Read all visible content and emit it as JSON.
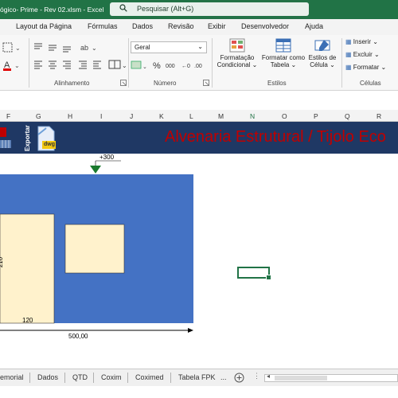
{
  "titlebar": {
    "file_title": "ógico- Prime - Rev 02.xlsm  -  Excel",
    "search_placeholder": "Pesquisar (Alt+G)"
  },
  "ribbon_tabs": [
    "Layout da Página",
    "Fórmulas",
    "Dados",
    "Revisão",
    "Exibir",
    "Desenvolvedor",
    "Ajuda"
  ],
  "ribbon": {
    "number_format": "Geral",
    "groups": {
      "alignment": "Alinhamento",
      "number": "Número",
      "styles": "Estilos",
      "cells": "Células"
    },
    "buttons": {
      "conditional_formatting": [
        "Formatação",
        "Condicional"
      ],
      "format_as_table": [
        "Formatar como",
        "Tabela"
      ],
      "cell_styles": [
        "Estilos de",
        "Célula"
      ],
      "insert": "Inserir",
      "delete": "Excluir",
      "format": "Formatar"
    },
    "font_size_a": "A",
    "percent": "%",
    "thousands": "000"
  },
  "columns": [
    "F",
    "G",
    "H",
    "I",
    "J",
    "K",
    "L",
    "M",
    "N",
    "O",
    "P",
    "Q",
    "R"
  ],
  "sheet": {
    "banner_title": "Alvenaria Estrutural / Tijolo Eco",
    "export_label": "Exportar",
    "dwg_label": "dwg",
    "drawing": {
      "top_marker": "+300",
      "width_label": "500,00",
      "inner_width_label": "120",
      "inner_height_label": "210"
    }
  },
  "sheet_tabs": [
    "emorial",
    "Dados",
    "QTD",
    "Coxim",
    "Coximed",
    "Tabela FPK",
    "..."
  ],
  "colors": {
    "excel_green": "#217346",
    "banner_bg": "#1f3864",
    "banner_text": "#c00000",
    "wall_blue": "#4472c4",
    "opening_fill": "#fff2cc"
  }
}
